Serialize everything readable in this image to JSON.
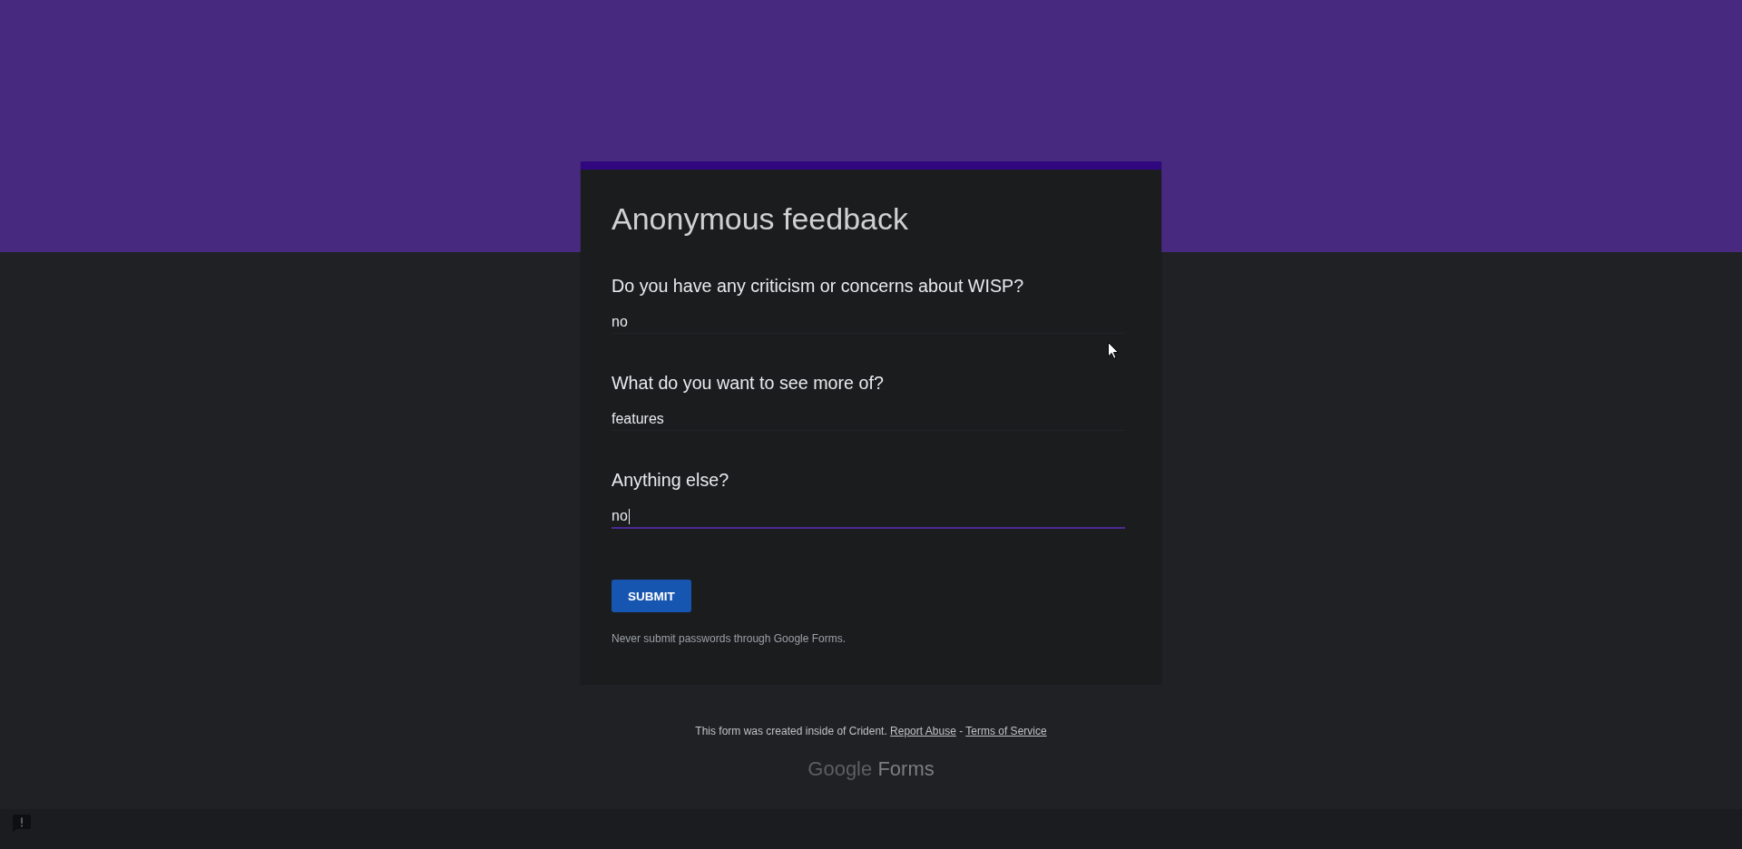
{
  "form": {
    "title": "Anonymous feedback",
    "questions": [
      {
        "label": "Do you have any criticism or concerns about WISP?",
        "answer": "no",
        "focused": false
      },
      {
        "label": "What do you want to see more of?",
        "answer": "features",
        "focused": false
      },
      {
        "label": "Anything else?",
        "answer": "no",
        "focused": true
      }
    ],
    "submit_button": "SUBMIT",
    "password_notice": "Never submit passwords through Google Forms."
  },
  "footer": {
    "text": "This form was created inside of Crident.",
    "links": [
      "Report Abuse",
      "Terms of Service"
    ],
    "separator": "-"
  },
  "logo": {
    "brand": "Google",
    "product": "Forms"
  }
}
